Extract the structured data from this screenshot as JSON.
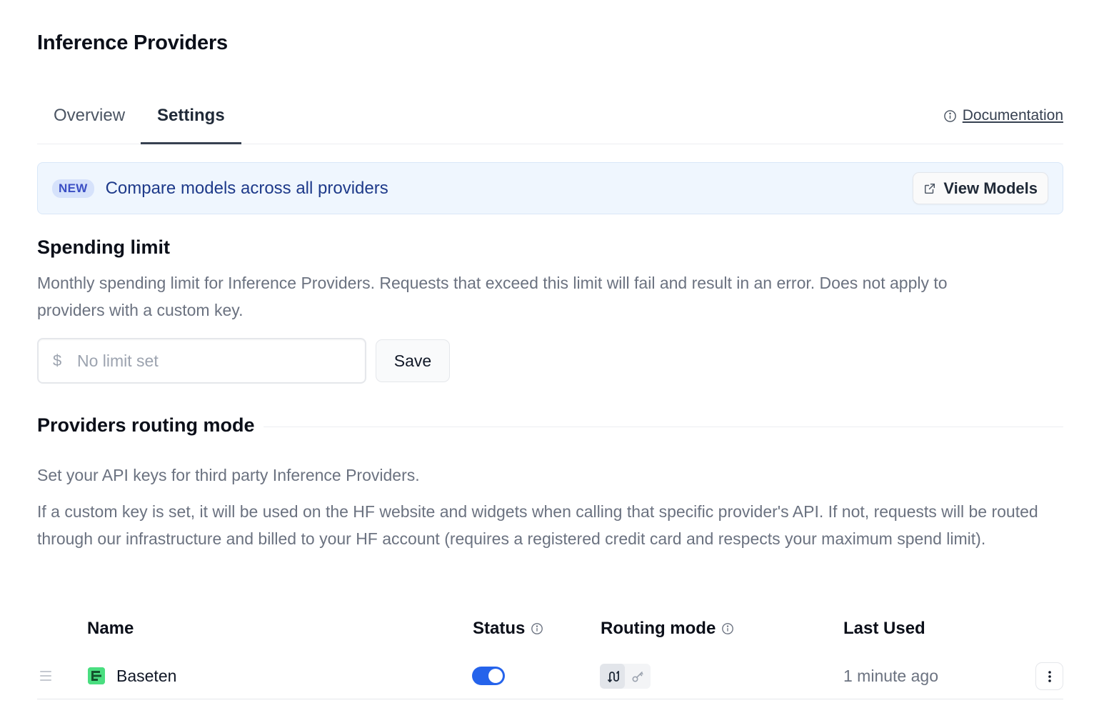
{
  "page": {
    "title": "Inference Providers"
  },
  "tabs": [
    {
      "label": "Overview",
      "active": false
    },
    {
      "label": "Settings",
      "active": true
    }
  ],
  "documentation": {
    "label": "Documentation",
    "icon": "info-circle-icon"
  },
  "banner": {
    "badge": "NEW",
    "text": "Compare models across all providers",
    "button_label": "View Models",
    "button_icon": "external-link-icon"
  },
  "spending": {
    "title": "Spending limit",
    "description": "Monthly spending limit for Inference Providers. Requests that exceed this limit will fail and result in an error. Does not apply to providers with a custom key.",
    "currency_symbol": "$",
    "input_value": "",
    "input_placeholder": "No limit set",
    "save_label": "Save"
  },
  "routing": {
    "title": "Providers routing mode",
    "description_1": "Set your API keys for third party Inference Providers.",
    "description_2": "If a custom key is set, it will be used on the HF website and widgets when calling that specific provider's API. If not, requests will be routed through our infrastructure and billed to your HF account (requires a registered credit card and respects your maximum spend limit)."
  },
  "table": {
    "columns": {
      "name": "Name",
      "status": "Status",
      "routing_mode": "Routing mode",
      "last_used": "Last Used"
    },
    "rows": [
      {
        "name": "Baseten",
        "status_enabled": true,
        "routing_mode": "routed-by-hf",
        "last_used": "1 minute ago"
      }
    ]
  },
  "colors": {
    "accent": "#2563eb",
    "banner_bg": "#eff6fe",
    "banner_text": "#1e3a8a",
    "provider_logo": "#4ade80"
  }
}
